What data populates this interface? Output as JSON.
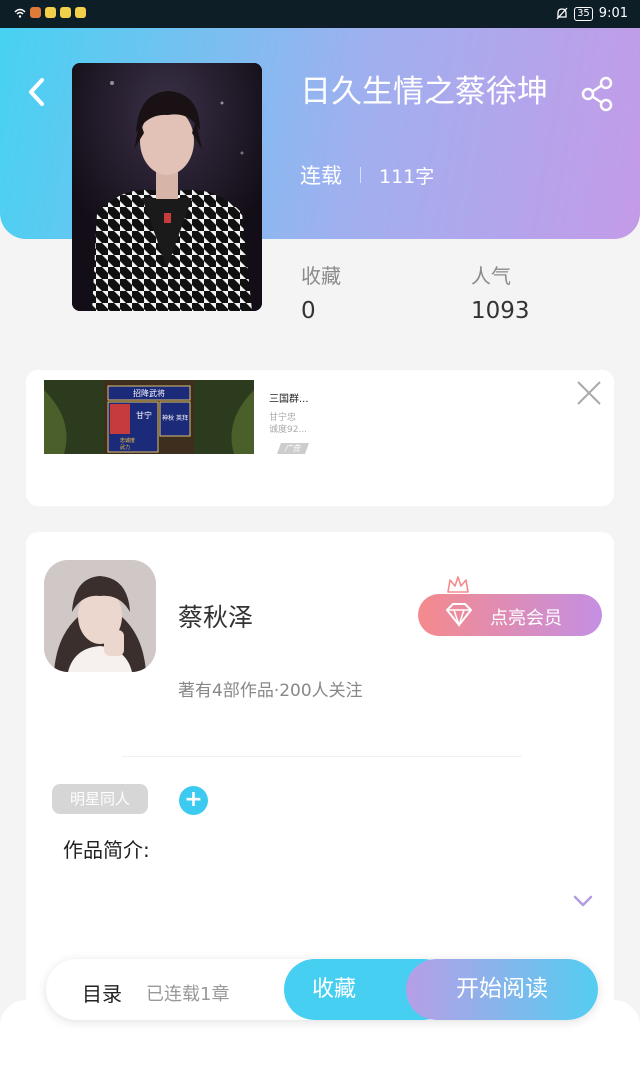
{
  "status_bar": {
    "time": "9:01",
    "battery": "35"
  },
  "book": {
    "title": "日久生情之蔡徐坤",
    "status": "连载",
    "word_count": "111字",
    "favorites_label": "收藏",
    "favorites_value": "0",
    "popularity_label": "人气",
    "popularity_value": "1093"
  },
  "ad": {
    "title": "三国群...",
    "desc_line1": "甘宁忠",
    "desc_line2": "诚度92...",
    "tag": "广告",
    "image_banner": "招降武将",
    "image_name": "甘宁",
    "image_skills": "神秋 英拜",
    "image_stat1": "忠诚度",
    "image_stat2": "武力"
  },
  "author": {
    "name": "蔡秋泽",
    "vip_label": "点亮会员",
    "works_info": "著有4部作品·200人关注"
  },
  "tags": [
    "明星同人"
  ],
  "intro_label": "作品简介:",
  "bottom_bar": {
    "toc_label": "目录",
    "updated_text": "已连载1章",
    "favorite_button": "收藏",
    "read_button": "开始阅读"
  },
  "colors": {
    "header_start": "#47d2f2",
    "header_end": "#c49be8",
    "accent_cyan": "#47cff2",
    "vip_start": "#f58a8c",
    "vip_end": "#c48fe3"
  }
}
